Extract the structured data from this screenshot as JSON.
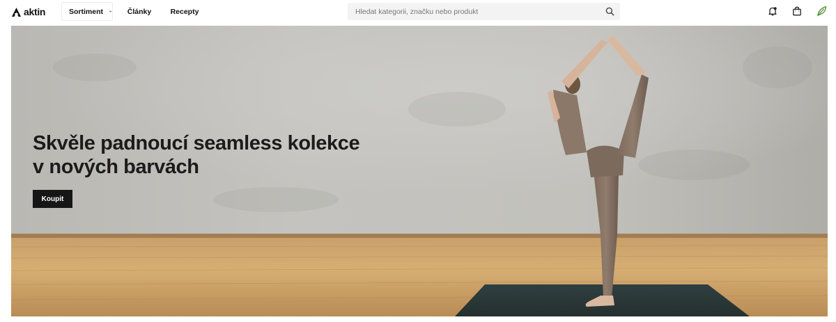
{
  "header": {
    "logo_text": "aktin",
    "nav": {
      "sortiment_label": "Sortiment",
      "clanky_label": "Články",
      "recepty_label": "Recepty"
    },
    "search": {
      "placeholder": "Hledat kategorii, značku nebo produkt",
      "value": ""
    },
    "icons": [
      "bell-icon",
      "shopping-bag-icon",
      "leaf-icon"
    ],
    "accent_color": "#4a8a2a"
  },
  "hero": {
    "title_line1": "Skvěle padnoucí seamless kolekce",
    "title_line2": "v nových barvách",
    "cta_label": "Koupit",
    "cta_color": "#161616",
    "image": "woman in brown seamless sportswear doing standing yoga pose on dark mat, concrete wall and wooden floor"
  }
}
